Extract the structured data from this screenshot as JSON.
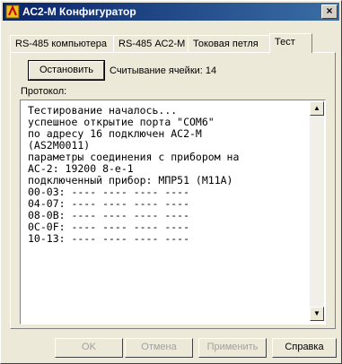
{
  "window": {
    "title": "АС2-М Конфигуратор",
    "close_glyph": "×"
  },
  "tabs": [
    {
      "label": "RS-485 компьютера"
    },
    {
      "label": "RS-485 АС2-М"
    },
    {
      "label": "Токовая петля"
    },
    {
      "label": "Тест"
    }
  ],
  "test": {
    "stop_label": "Остановить",
    "cell_read_label": "Считывание ячейки: 14",
    "protocol_label": "Протокол:",
    "log": "Тестирование началось...\nуспешное открытие порта \"COM6\"\nпо адресу 16 подключен АС2-М\n(AS2M0011)\nпараметры соединения с прибором на\nАС-2: 19200 8-е-1\nподключенный прибор: МПР51 (М11А)\n00-03: ---- ---- ---- ----\n04-07: ---- ---- ---- ----\n08-0B: ---- ---- ---- ----\n0C-0F: ---- ---- ---- ----\n10-13: ---- ---- ---- ----"
  },
  "footer": {
    "ok": "OK",
    "cancel": "Отмена",
    "apply": "Применить",
    "help": "Справка"
  },
  "colors": {
    "titlebar": "#0a246a",
    "face": "#ece9d8"
  }
}
